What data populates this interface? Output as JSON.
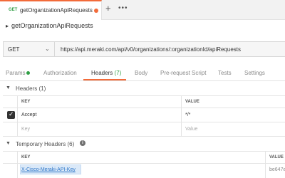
{
  "tab": {
    "method": "GET",
    "name": "getOrganizationApiRequests"
  },
  "tabbar": {
    "new_tab": "+",
    "more": "•••"
  },
  "title": {
    "caret": "▸",
    "text": "getOrganizationApiRequests"
  },
  "request": {
    "method": "GET",
    "url": "https://api.meraki.com/api/v0/organizations/:organizationId/apiRequests"
  },
  "request_tabs": [
    {
      "label": "Params"
    },
    {
      "label": "Authorization"
    },
    {
      "label": "Headers",
      "count": "(7)"
    },
    {
      "label": "Body"
    },
    {
      "label": "Pre-request Script"
    },
    {
      "label": "Tests"
    },
    {
      "label": "Settings"
    }
  ],
  "headers_section": {
    "title": "Headers (1)",
    "columns": [
      "KEY",
      "VALUE"
    ],
    "rows": [
      {
        "checked": true,
        "key": "Accept",
        "value": "*/*"
      }
    ],
    "placeholder": {
      "key": "Key",
      "value": "Value"
    }
  },
  "temp_section": {
    "title": "Temporary Headers (6)",
    "columns": [
      "KEY",
      "VALUE"
    ],
    "rows": [
      {
        "key": "X-Cisco-Meraki-API-Key",
        "value": "be647e"
      }
    ]
  },
  "colors": {
    "accent": "#f26b3a",
    "success": "#2f9e44",
    "link": "#2b74c7"
  }
}
